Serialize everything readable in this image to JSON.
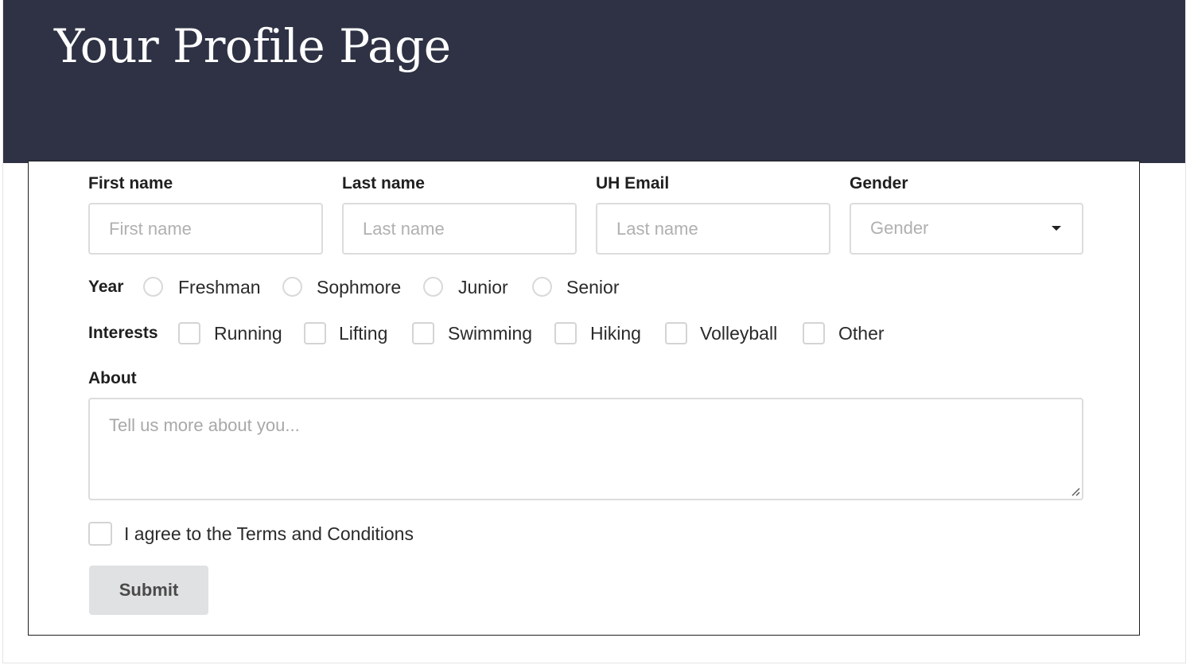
{
  "header": {
    "title": "Your Profile Page",
    "background": "#2e3244"
  },
  "form": {
    "first_name": {
      "label": "First name",
      "placeholder": "First name"
    },
    "last_name": {
      "label": "Last name",
      "placeholder": "Last name"
    },
    "uh_email": {
      "label": "UH Email",
      "placeholder": "Last name"
    },
    "gender": {
      "label": "Gender",
      "placeholder": "Gender"
    },
    "year": {
      "label": "Year",
      "options": [
        "Freshman",
        "Sophmore",
        "Junior",
        "Senior"
      ]
    },
    "interests": {
      "label": "Interests",
      "options": [
        "Running",
        "Lifting",
        "Swimming",
        "Hiking",
        "Volleyball",
        "Other"
      ]
    },
    "about": {
      "label": "About",
      "placeholder": "Tell us more about you..."
    },
    "terms": {
      "label": "I agree to the Terms and Conditions"
    },
    "submit_label": "Submit"
  },
  "icons": {
    "gender_caret": "caret-down-icon",
    "textarea_resize": "resize-grip-icon"
  }
}
